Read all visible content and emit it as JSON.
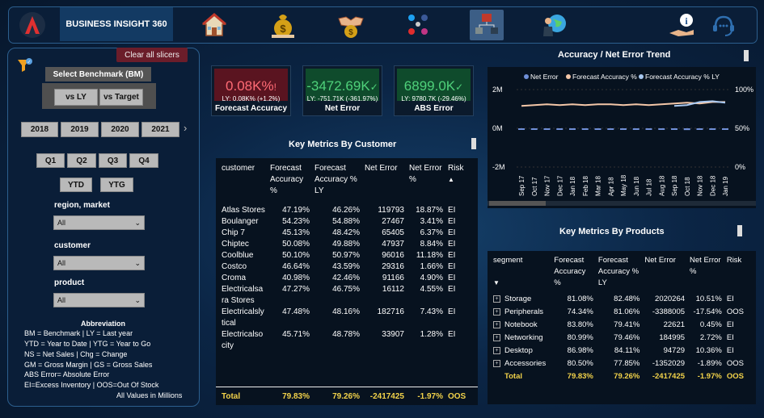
{
  "app": {
    "title": "BUSINESS INSIGHT 360"
  },
  "nav": {
    "icons": [
      "home-icon",
      "finance-money-bag-icon",
      "sales-handshake-icon",
      "marketing-social-icon",
      "supply-chain-icon",
      "executive-globe-icon",
      "info-icon",
      "support-headset-icon"
    ],
    "active": "supply-chain-icon"
  },
  "sidebar": {
    "clear_label": "Clear all slicers",
    "benchmark_label": "Select Benchmark (BM)",
    "benchmarks": [
      "vs LY",
      "vs Target"
    ],
    "years": [
      "2018",
      "2019",
      "2020",
      "2021"
    ],
    "quarters": [
      "Q1",
      "Q2",
      "Q3",
      "Q4"
    ],
    "periods": [
      "YTD",
      "YTG"
    ],
    "filters": [
      {
        "label": "region, market",
        "value": "All"
      },
      {
        "label": "customer",
        "value": "All"
      },
      {
        "label": "product",
        "value": "All"
      }
    ],
    "abbr_title": "Abbreviation",
    "abbr_lines": [
      "BM = Benchmark | LY = Last year",
      "YTD = Year to Date | YTG = Year to Go",
      "NS = Net Sales | Chg = Change",
      "GM = Gross Margin | GS = Gross Sales",
      "ABS Error= Absolute Error",
      "EI=Excess Inventory | OOS=Out Of Stock"
    ],
    "values_note": "All Values in Millions"
  },
  "kpis": [
    {
      "value": "0.08K%",
      "arrow": "!",
      "ly": "LY: 0.08K% (+1.2%)",
      "title": "Forecast Accuracy",
      "color": "#e0505a",
      "bg": "#5a1420"
    },
    {
      "value": "-3472.69K",
      "arrow": "✓",
      "ly": "LY: -751.71K (-361.97%)",
      "title": "Net Error",
      "color": "#4fd17a",
      "bg": "#0f4b2c"
    },
    {
      "value": "6899.0K",
      "arrow": "✓",
      "ly": "LY: 9780.7K (-29.46%)",
      "title": "ABS Error",
      "color": "#4fd17a",
      "bg": "#0f4b2c"
    }
  ],
  "customer_table": {
    "title": "Key Metrics By Customer",
    "headers": [
      "customer",
      "Forecast Accuracy %",
      "Forecast Accuracy % LY",
      "Net Error",
      "Net Error %",
      "Risk"
    ],
    "rows": [
      [
        "Atlas Stores",
        "47.19%",
        "46.26%",
        "119793",
        "18.87%",
        "EI"
      ],
      [
        "Boulanger",
        "54.23%",
        "54.88%",
        "27467",
        "3.41%",
        "EI"
      ],
      [
        "Chip 7",
        "45.13%",
        "48.42%",
        "65405",
        "6.37%",
        "EI"
      ],
      [
        "Chiptec",
        "50.08%",
        "49.88%",
        "47937",
        "8.84%",
        "EI"
      ],
      [
        "Coolblue",
        "50.10%",
        "50.97%",
        "96016",
        "11.18%",
        "EI"
      ],
      [
        "Costco",
        "46.64%",
        "43.59%",
        "29316",
        "1.66%",
        "EI"
      ],
      [
        "Croma",
        "40.98%",
        "42.46%",
        "91166",
        "4.90%",
        "EI"
      ],
      [
        "Electricalsara Stores",
        "47.27%",
        "46.75%",
        "16112",
        "4.55%",
        "EI"
      ],
      [
        "Electricalslytical",
        "47.48%",
        "48.16%",
        "182716",
        "7.43%",
        "EI"
      ],
      [
        "Electricalsocity",
        "45.71%",
        "48.78%",
        "33907",
        "1.28%",
        "EI"
      ]
    ],
    "total": [
      "Total",
      "79.83%",
      "79.26%",
      "-2417425",
      "-1.97%",
      "OOS"
    ]
  },
  "product_table": {
    "title": "Key Metrics By Products",
    "headers": [
      "segment",
      "Forecast Accuracy %",
      "Forecast Accuracy % LY",
      "Net Error",
      "Net Error %",
      "Risk"
    ],
    "rows": [
      [
        "Storage",
        "81.08%",
        "82.48%",
        "2020264",
        "10.51%",
        "EI"
      ],
      [
        "Peripherals",
        "74.34%",
        "81.06%",
        "-3388005",
        "-17.54%",
        "OOS"
      ],
      [
        "Notebook",
        "83.80%",
        "79.41%",
        "22621",
        "0.45%",
        "EI"
      ],
      [
        "Networking",
        "80.99%",
        "79.46%",
        "184995",
        "2.72%",
        "EI"
      ],
      [
        "Desktop",
        "86.98%",
        "84.11%",
        "94729",
        "10.36%",
        "EI"
      ],
      [
        "Accessories",
        "80.50%",
        "77.85%",
        "-1352029",
        "-1.89%",
        "OOS"
      ]
    ],
    "total": [
      "Total",
      "79.83%",
      "79.26%",
      "-2417425",
      "-1.97%",
      "OOS"
    ]
  },
  "chart_data": {
    "type": "line",
    "title": "Accuracy / Net Error Trend",
    "legend": [
      "Net Error",
      "Forecast Accuracy %",
      "Forecast Accuracy % LY"
    ],
    "legend_position": "top",
    "series_colors": [
      "#6f8fd8",
      "#f4c7a8",
      "#a8c8f0"
    ],
    "x": [
      "Sep 17",
      "Oct 17",
      "Nov 17",
      "Dec 17",
      "Jan 18",
      "Feb 18",
      "Mar 18",
      "Apr 18",
      "May 18",
      "Jun 18",
      "Jul 18",
      "Aug 18",
      "Sep 18",
      "Oct 18",
      "Nov 18",
      "Dec 18",
      "Jan 19"
    ],
    "y_left_ticks": [
      "2M",
      "0M",
      "-2M"
    ],
    "y_right_ticks": [
      "100%",
      "50%",
      "0%"
    ],
    "y_left_range": [
      -2000000,
      2000000
    ],
    "y_right_range": [
      0,
      1
    ],
    "series": [
      {
        "name": "Net Error",
        "axis": "left",
        "values": [
          -50000,
          -40000,
          -60000,
          -50000,
          -40000,
          -60000,
          -50000,
          -45000,
          -55000,
          -50000,
          -40000,
          -60000,
          -70000,
          -90000,
          -60000,
          -80000,
          -70000
        ]
      },
      {
        "name": "Forecast Accuracy %",
        "axis": "right",
        "values": [
          0.79,
          0.8,
          0.81,
          0.8,
          0.81,
          0.8,
          0.81,
          0.81,
          0.8,
          0.81,
          0.8,
          0.81,
          0.82,
          0.83,
          0.82,
          0.84,
          0.84
        ]
      },
      {
        "name": "Forecast Accuracy % LY",
        "axis": "right",
        "values": [
          null,
          null,
          null,
          null,
          null,
          null,
          null,
          null,
          null,
          null,
          null,
          null,
          0.79,
          0.8,
          0.84,
          0.85,
          0.83
        ]
      }
    ]
  }
}
